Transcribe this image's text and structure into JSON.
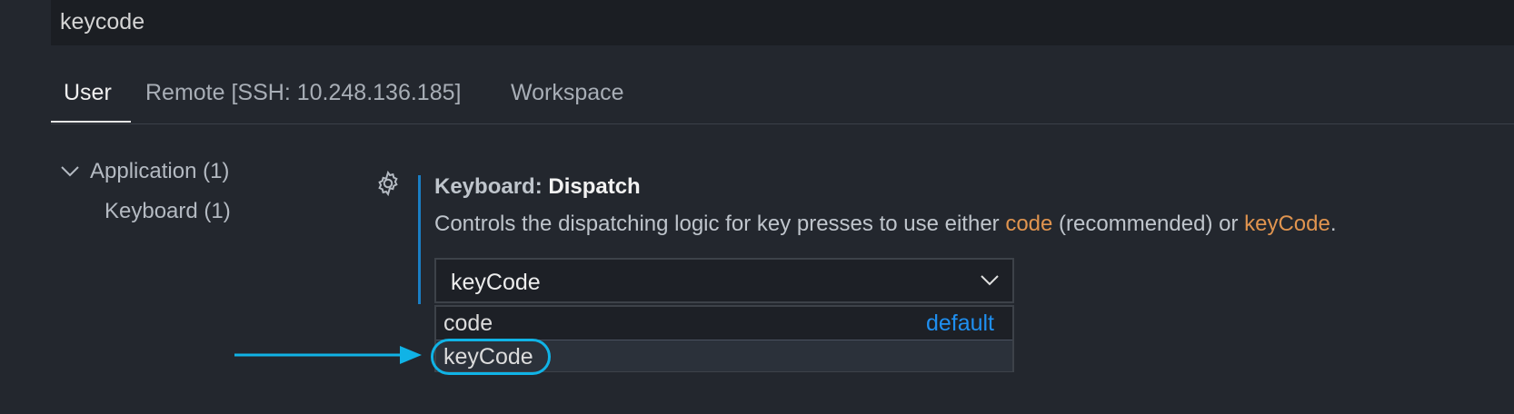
{
  "search": {
    "value": "keycode"
  },
  "tabs": [
    {
      "label": "User"
    },
    {
      "label": "Remote [SSH: 10.248.136.185]"
    },
    {
      "label": "Workspace"
    }
  ],
  "toc": {
    "group_label": "Application (1)",
    "item_label": "Keyboard (1)"
  },
  "setting": {
    "category": "Keyboard: ",
    "name": "Dispatch",
    "description_prefix": "Controls the dispatching logic for key presses to use either ",
    "description_code": "code",
    "description_middle": " (recommended) or ",
    "description_keycode": "keyCode",
    "description_suffix": ".",
    "selected_value": "keyCode",
    "options": [
      {
        "label": "code",
        "badge": "default"
      },
      {
        "label": "keyCode"
      }
    ]
  },
  "colors": {
    "background": "#23272e",
    "accent_blue": "#1a7ec4",
    "link_orange": "#e0944f",
    "default_blue": "#1f8ff0",
    "annotation_cyan": "#10b3e6"
  },
  "icons": [
    "chevron-down-icon",
    "gear-icon",
    "arrow-right-icon"
  ]
}
